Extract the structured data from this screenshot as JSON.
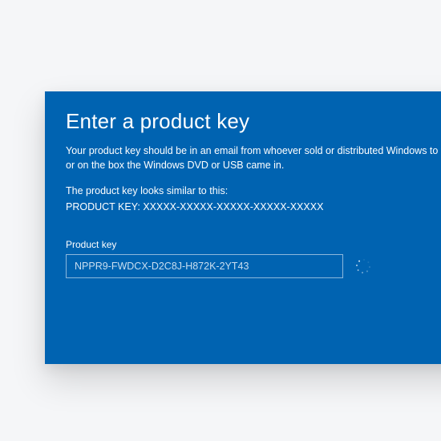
{
  "dialog": {
    "title": "Enter a product key",
    "description": "Your product key should be in an email from whoever sold or distributed Windows to you, or on the box the Windows DVD or USB came in.",
    "similar_label": "The product key looks similar to this:",
    "similar_example": "PRODUCT KEY: XXXXX-XXXXX-XXXXX-XXXXX-XXXXX",
    "field_label": "Product key",
    "input_value": "NPPR9-FWDCX-D2C8J-H872K-2YT43"
  },
  "colors": {
    "background": "#0063b1",
    "text": "#ffffff"
  }
}
